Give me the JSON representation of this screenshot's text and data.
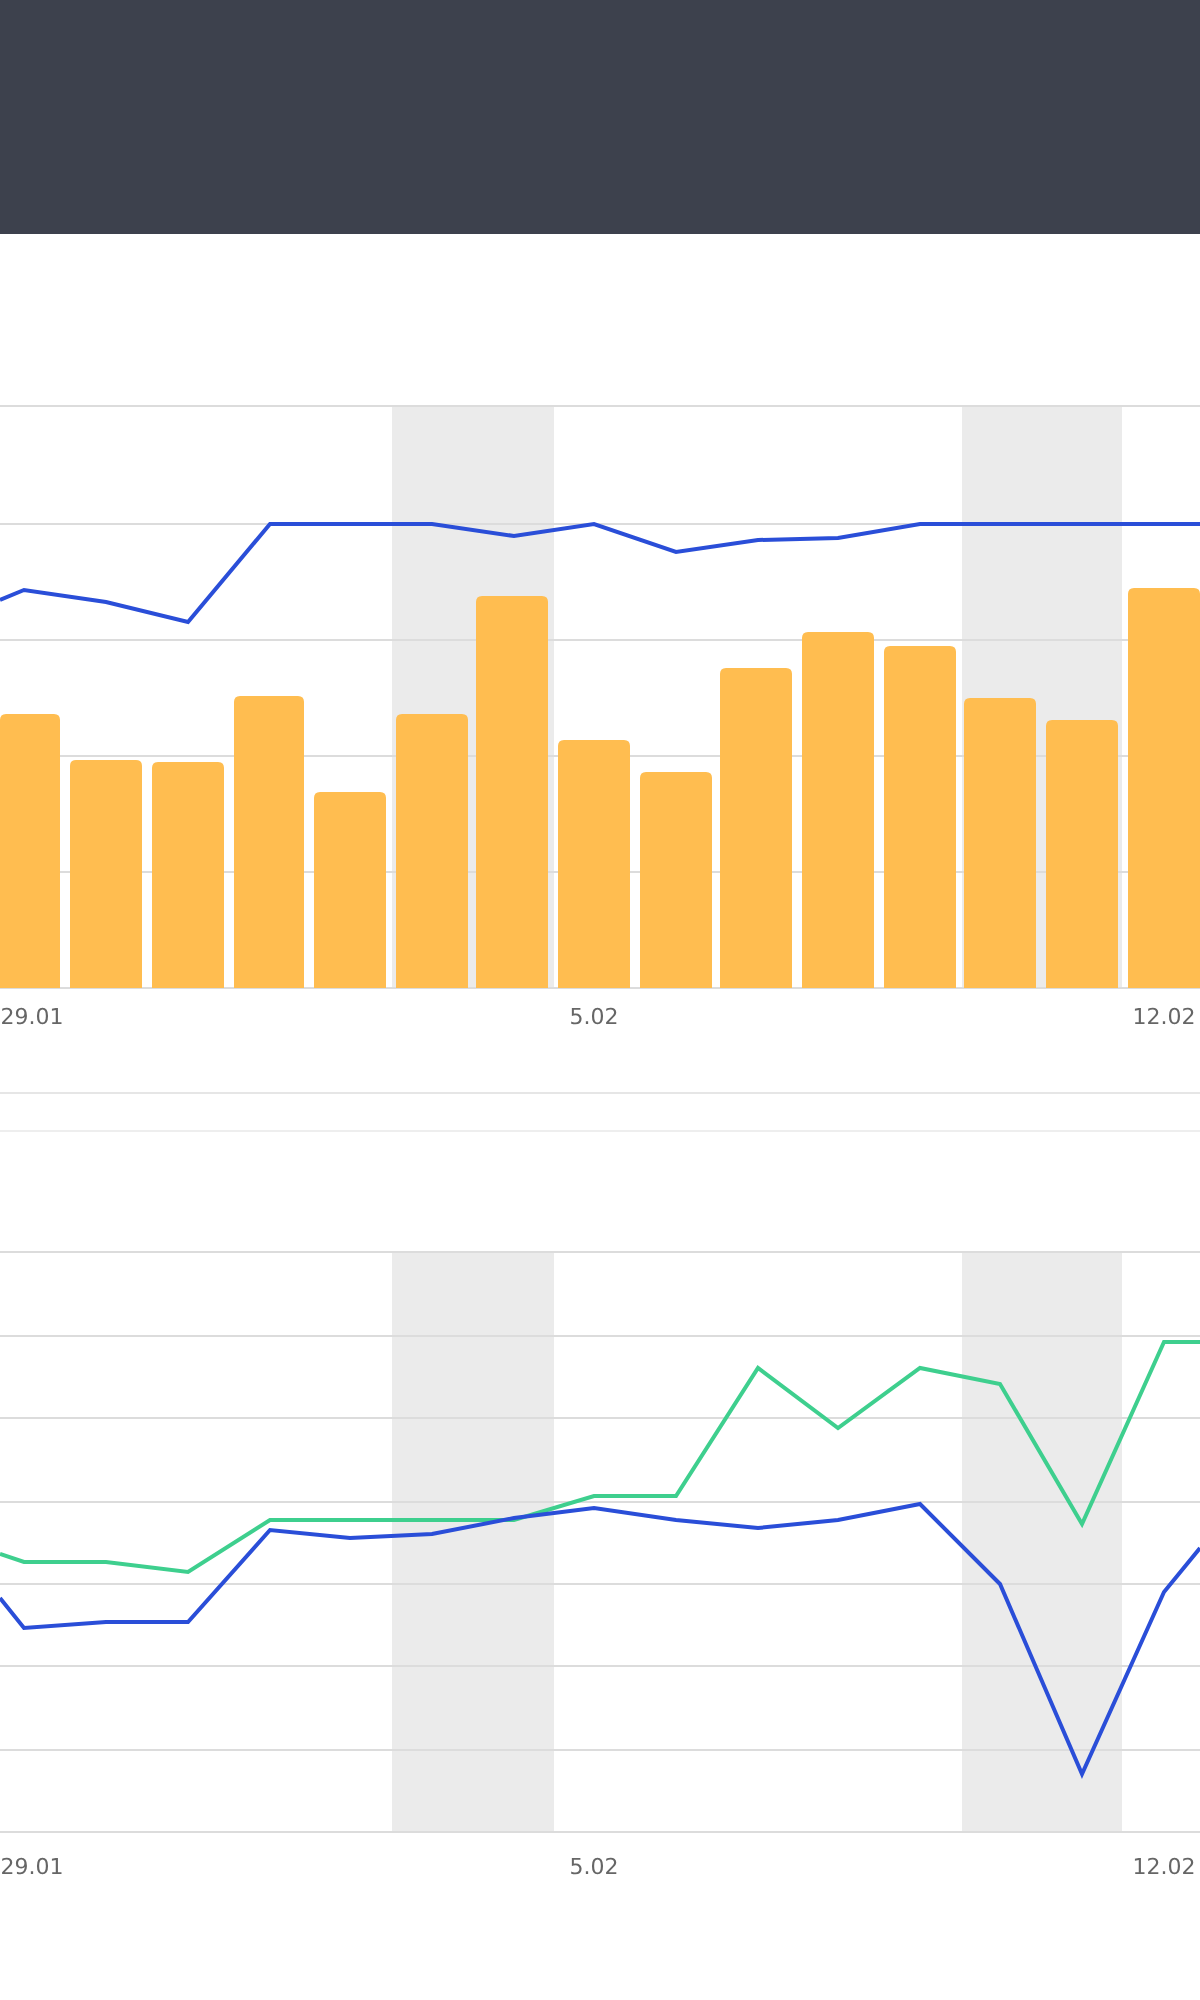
{
  "charts": [
    {
      "kind": "bars-line",
      "axis_labels": [
        "29.01",
        "5.02",
        "12.02"
      ]
    },
    {
      "kind": "two-lines",
      "axis_labels": [
        "29.01",
        "5.02",
        "12.02"
      ]
    }
  ]
}
